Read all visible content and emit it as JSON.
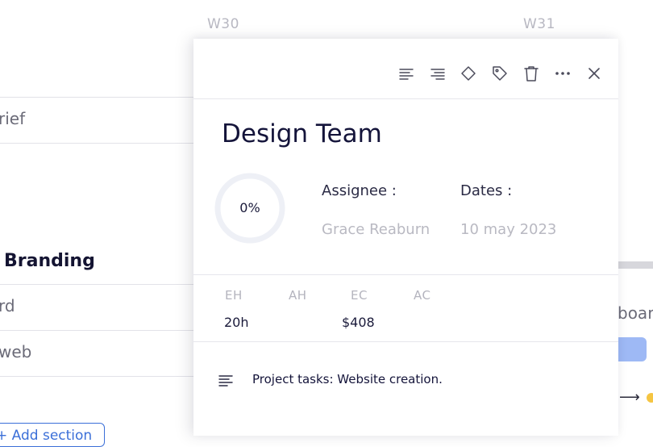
{
  "timeline": {
    "weeks": [
      "W30",
      "W31"
    ]
  },
  "left_panel": {
    "rows": [
      {
        "text": "rief"
      },
      {
        "text": "Branding",
        "heading": true
      },
      {
        "text": "rd"
      },
      {
        "text": "web"
      }
    ],
    "add_section_label": "+ Add section"
  },
  "right_strip": {
    "partial_text": "boar"
  },
  "panel": {
    "toolbar": {
      "icons": [
        "align-left-icon",
        "align-right-icon",
        "diamond-icon",
        "tag-icon",
        "trash-icon",
        "more-icon",
        "close-icon"
      ]
    },
    "title": "Design Team",
    "progress": {
      "value": 0,
      "label": "0%"
    },
    "assignee": {
      "label": "Assignee :",
      "value": "Grace Reaburn"
    },
    "dates": {
      "label": "Dates :",
      "value": "10 may 2023"
    },
    "metrics": {
      "eh": {
        "label": "EH",
        "value": "20h"
      },
      "ah": {
        "label": "AH",
        "value": ""
      },
      "ec": {
        "label": "EC",
        "value": "$408"
      },
      "ac": {
        "label": "AC",
        "value": ""
      }
    },
    "description": "Project tasks: Website creation."
  },
  "colors": {
    "accent": "#3b6fd8",
    "title": "#14143a",
    "muted": "#b9b9c2",
    "progress_track": "#eef0f6"
  }
}
